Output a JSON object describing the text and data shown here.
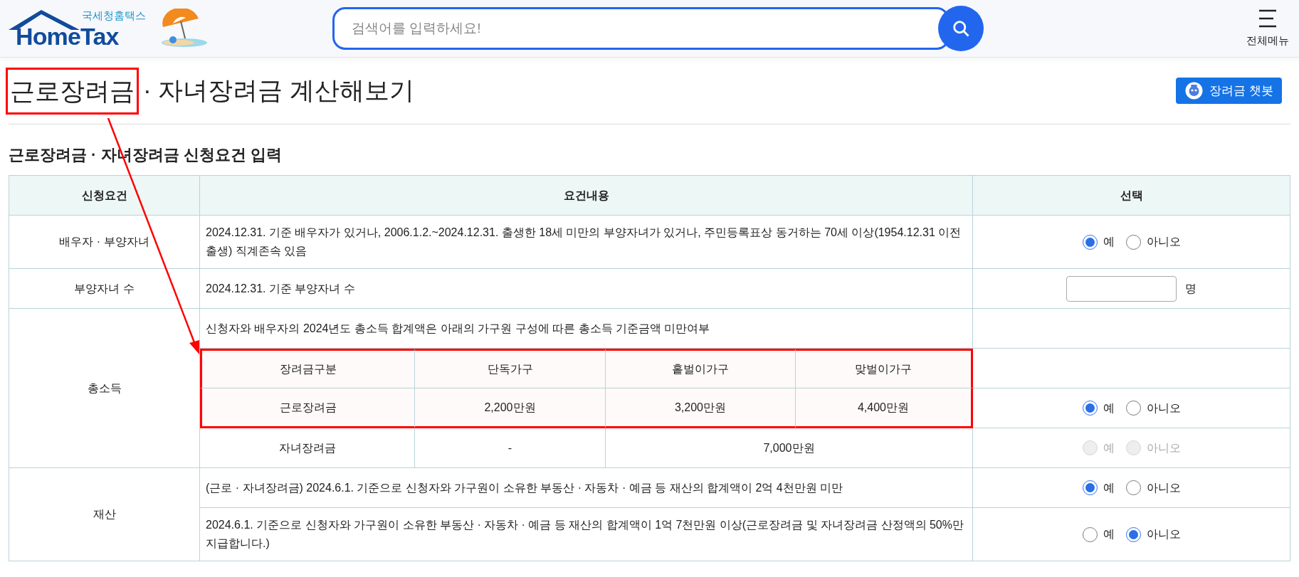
{
  "header": {
    "logo": {
      "subtitle": "국세청홈택스",
      "name": "HomeTax"
    },
    "search": {
      "placeholder": "검색어를 입력하세요!"
    },
    "menu": {
      "label": "전체메뉴"
    }
  },
  "page": {
    "title_highlighted": "근로장려금",
    "title_rest": "· 자녀장려금 계산해보기",
    "chatbot_button": "장려금 챗봇",
    "section_title": "근로장려금 · 자녀장려금 신청요건 입력"
  },
  "table": {
    "columns": [
      "신청요건",
      "요건내용",
      "선택"
    ],
    "groups": [
      {
        "label": "배우자 · 부양자녀",
        "rows": [
          {
            "kind": "text",
            "text": "2024.12.31. 기준 배우자가 있거나, 2006.1.2.~2024.12.31. 출생한 18세 미만의 부양자녀가 있거나, 주민등록표상 동거하는 70세 이상(1954.12.31 이전 출생) 직계존속 있음",
            "choice": {
              "kind": "radio",
              "disabled": false,
              "options": [
                {
                  "label": "예",
                  "selected": true
                },
                {
                  "label": "아니오",
                  "selected": false
                }
              ]
            }
          }
        ]
      },
      {
        "label": "부양자녀 수",
        "rows": [
          {
            "kind": "text",
            "text": "2024.12.31. 기준 부양자녀 수",
            "choice": {
              "kind": "count",
              "unit": "명"
            }
          }
        ]
      },
      {
        "label": "총소득",
        "rows": [
          {
            "kind": "text",
            "text": "신청자와 배우자의 2024년도 총소득 합계액은 아래의 가구원 구성에 따른 총소득 기준금액 미만여부"
          },
          {
            "kind": "grid",
            "highlighted": true,
            "cells": [
              "장려금구분",
              "단독가구",
              "홑벌이가구",
              "맞벌이가구"
            ]
          },
          {
            "kind": "grid",
            "highlighted": true,
            "cells": [
              "근로장려금",
              "2,200만원",
              "3,200만원",
              "4,400만원"
            ],
            "choice": {
              "kind": "radio",
              "disabled": false,
              "options": [
                {
                  "label": "예",
                  "selected": true
                },
                {
                  "label": "아니오",
                  "selected": false
                }
              ]
            }
          },
          {
            "kind": "grid",
            "highlighted": false,
            "cells": [
              "자녀장려금",
              "-",
              "7,000만원"
            ],
            "choice": {
              "kind": "radio",
              "disabled": true,
              "options": [
                {
                  "label": "예",
                  "selected": false
                },
                {
                  "label": "아니오",
                  "selected": false
                }
              ]
            }
          }
        ]
      },
      {
        "label": "재산",
        "rows": [
          {
            "kind": "text",
            "text": "(근로 · 자녀장려금) 2024.6.1. 기준으로 신청자와 가구원이 소유한 부동산 · 자동차 · 예금 등 재산의 합계액이 2억 4천만원 미만",
            "choice": {
              "kind": "radio",
              "disabled": false,
              "options": [
                {
                  "label": "예",
                  "selected": true
                },
                {
                  "label": "아니오",
                  "selected": false
                }
              ]
            }
          },
          {
            "kind": "text",
            "text": "2024.6.1. 기준으로 신청자와 가구원이 소유한 부동산 · 자동차 · 예금 등 재산의 합계액이 1억 7천만원 이상(근로장려금 및 자녀장려금 산정액의 50%만 지급합니다.)",
            "choice": {
              "kind": "radio",
              "disabled": false,
              "options": [
                {
                  "label": "예",
                  "selected": false
                },
                {
                  "label": "아니오",
                  "selected": true
                }
              ]
            }
          }
        ]
      }
    ]
  }
}
